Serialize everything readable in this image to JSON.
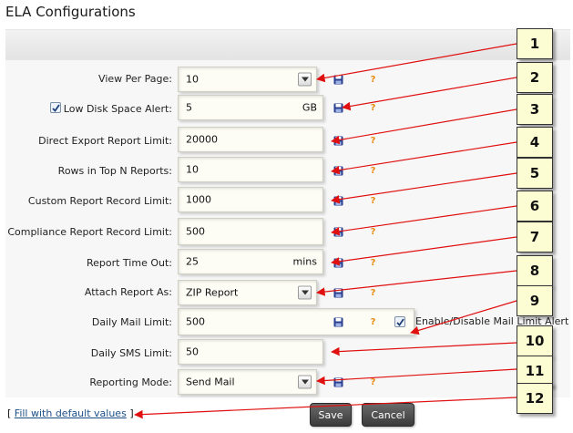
{
  "page_title": "ELA Configurations",
  "rows": [
    {
      "label": "View Per Page:",
      "value": "10",
      "unit": "",
      "type": "select"
    },
    {
      "label": "Low Disk Space Alert:",
      "value": "5",
      "unit": "GB",
      "type": "input",
      "checked": true
    },
    {
      "label": "Direct Export Report Limit:",
      "value": "20000",
      "unit": "",
      "type": "input"
    },
    {
      "label": "Rows in Top N Reports:",
      "value": "10",
      "unit": "",
      "type": "input"
    },
    {
      "label": "Custom Report Record Limit:",
      "value": "1000",
      "unit": "",
      "type": "input"
    },
    {
      "label": "Compliance Report Record Limit:",
      "value": "500",
      "unit": "",
      "type": "input"
    },
    {
      "label": "Report Time Out:",
      "value": "25",
      "unit": "mins",
      "type": "input"
    },
    {
      "label": "Attach Report As:",
      "value": "ZIP Report",
      "unit": "",
      "type": "select"
    },
    {
      "label": "Daily Mail Limit:",
      "value": "500",
      "unit": "",
      "type": "input"
    },
    {
      "label": "Daily SMS Limit:",
      "value": "50",
      "unit": "",
      "type": "input"
    },
    {
      "label": "Reporting Mode:",
      "value": "Send Mail",
      "unit": "",
      "type": "select"
    }
  ],
  "mail_limit_alert": {
    "label": "Enable/Disable Mail Limit Alert",
    "checked": true
  },
  "fill_defaults": {
    "open": "[",
    "label": "Fill with default values",
    "close": "]"
  },
  "buttons": {
    "save": "Save",
    "cancel": "Cancel"
  },
  "callouts": [
    "1",
    "2",
    "3",
    "4",
    "5",
    "6",
    "7",
    "8",
    "9",
    "10",
    "11",
    "12"
  ],
  "icons": {
    "save": "floppy-disk",
    "help": "question-mark",
    "help_glyph": "?"
  },
  "colors": {
    "arrow": "#e01010",
    "callout_bg": "#fdfdd3",
    "help": "#e98b0f",
    "save_icon": "#2a3f8f"
  }
}
